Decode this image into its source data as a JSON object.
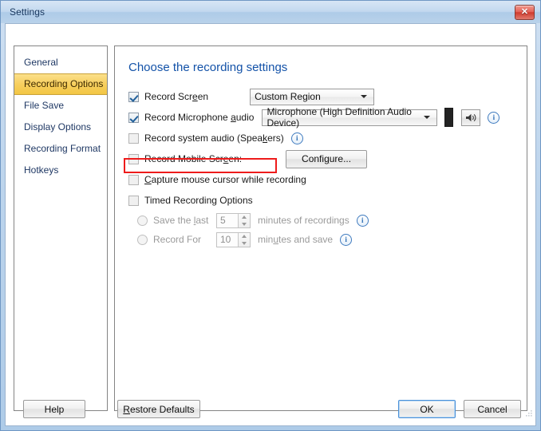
{
  "window": {
    "title": "Settings",
    "close_label": "✕"
  },
  "sidebar": {
    "items": [
      {
        "label": "General",
        "selected": false
      },
      {
        "label": "Recording Options",
        "selected": true
      },
      {
        "label": "File Save",
        "selected": false
      },
      {
        "label": "Display Options",
        "selected": false
      },
      {
        "label": "Recording Format",
        "selected": false
      },
      {
        "label": "Hotkeys",
        "selected": false
      }
    ]
  },
  "main": {
    "heading": "Choose the recording settings",
    "record_screen": {
      "label_pre": "Record Scr",
      "label_accel": "e",
      "label_post": "en",
      "checked": true,
      "combo_value": "Custom Region"
    },
    "record_mic": {
      "label_pre": "Record Microphone ",
      "label_accel": "a",
      "label_post": "udio",
      "checked": true,
      "combo_value": "Microphone (High Definition Audio Device)",
      "speaker_icon": "speaker-icon",
      "info_icon": "info-icon"
    },
    "record_system_audio": {
      "label_pre": "Record system audio (Spea",
      "label_accel": "k",
      "label_post": "ers)",
      "checked": false,
      "info_icon": "info-icon"
    },
    "record_mobile": {
      "label_pre": "Record Mobile Scr",
      "label_accel": "e",
      "label_post": "en:",
      "checked": false,
      "button_pre": "Confi",
      "button_accel": "g",
      "button_post": "ure..."
    },
    "capture_cursor": {
      "label_accel": "C",
      "label_post": "apture mouse cursor while recording",
      "checked": false,
      "highlighted": true,
      "highlight_color": "#ee1b1b"
    },
    "timed_recording": {
      "label": "Timed Recording Options",
      "checked": false,
      "save_last": {
        "label_pre": "Save the ",
        "label_accel": "l",
        "label_post": "ast",
        "value": "5",
        "suffix": "minutes of recordings",
        "selected": false,
        "info_icon": "info-icon"
      },
      "record_for": {
        "label": "Record For",
        "value": "10",
        "suffix_pre": "min",
        "suffix_accel": "u",
        "suffix_post": "tes and save",
        "selected": false,
        "info_icon": "info-icon"
      }
    }
  },
  "footer": {
    "help": "Help",
    "restore_pre": "",
    "restore_accel": "R",
    "restore_post": "estore Defaults",
    "ok": "OK",
    "cancel": "Cancel"
  }
}
